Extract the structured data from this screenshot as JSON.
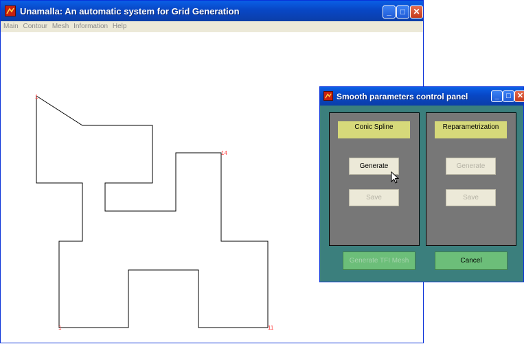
{
  "main_window": {
    "title": "Unamalla: An automatic system for Grid Generation",
    "menu": [
      "Main",
      "Contour",
      "Mesh",
      "Information",
      "Help"
    ]
  },
  "canvas": {
    "markers": [
      "1",
      "14",
      "1",
      "11"
    ]
  },
  "dialog": {
    "title": "Smooth parameters control panel",
    "left_panel": {
      "label": "Conic Spline",
      "generate_label": "Generate",
      "save_label": "Save"
    },
    "right_panel": {
      "label": "Reparametrization",
      "generate_label": "Generate",
      "save_label": "Save"
    },
    "generate_tfi_label": "Generate TFI Mesh",
    "cancel_label": "Cancel"
  },
  "colors": {
    "titlebar": "#0a5fe6",
    "dialog_bg": "#3b7f7d",
    "panel_bg": "#777777",
    "label_bg": "#d6d97a",
    "green_button": "#6cbe79",
    "marker": "#ff4040"
  },
  "icons": {
    "app": "matlab-icon",
    "minimize": "minimize-icon",
    "maximize": "maximize-icon",
    "close": "close-icon",
    "cursor": "mouse-pointer-icon"
  }
}
